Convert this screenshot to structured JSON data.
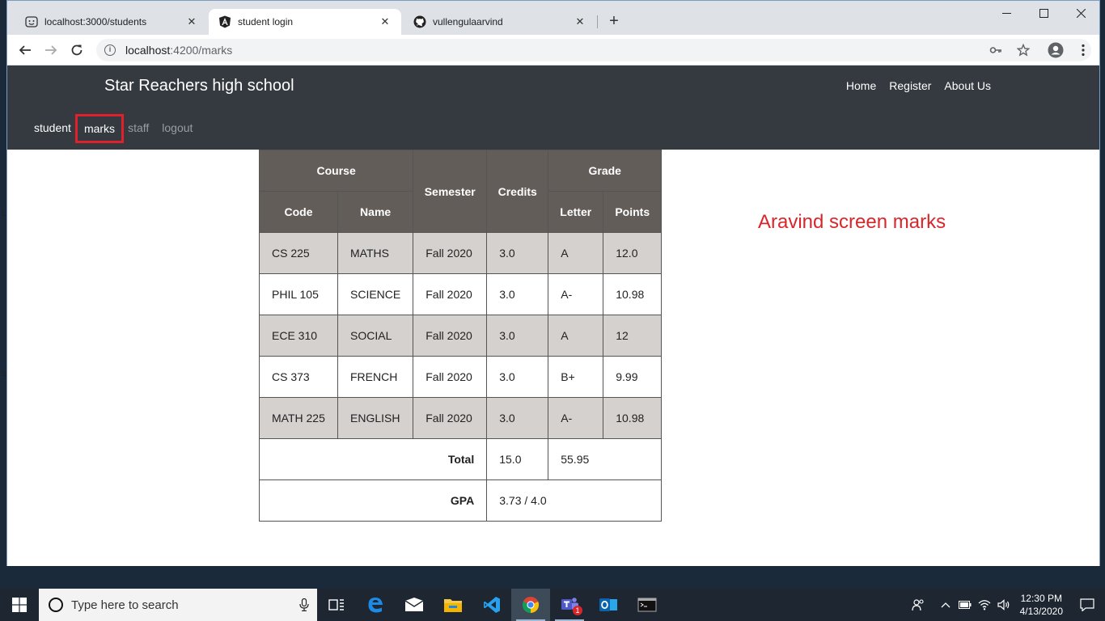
{
  "browser": {
    "tabs": [
      {
        "title": "localhost:3000/students",
        "icon": "smiley-favicon-icon"
      },
      {
        "title": "student login",
        "icon": "angular-icon"
      },
      {
        "title": "vullengulaarvind",
        "icon": "github-icon"
      }
    ],
    "url_host": "localhost",
    "url_rest": ":4200/marks"
  },
  "site": {
    "brand": "Star Reachers high school",
    "top_nav": [
      "Home",
      "Register",
      "About Us"
    ],
    "sub_nav": [
      "student",
      "marks",
      "staff",
      "logout"
    ]
  },
  "marks_table": {
    "headers": {
      "course": "Course",
      "code": "Code",
      "name": "Name",
      "semester": "Semester",
      "credits": "Credits",
      "grade": "Grade",
      "letter": "Letter",
      "points": "Points"
    },
    "rows": [
      {
        "code": "CS 225",
        "name": "MATHS",
        "semester": "Fall 2020",
        "credits": "3.0",
        "letter": "A",
        "points": "12.0"
      },
      {
        "code": "PHIL 105",
        "name": "SCIENCE",
        "semester": "Fall 2020",
        "credits": "3.0",
        "letter": "A-",
        "points": "10.98"
      },
      {
        "code": "ECE 310",
        "name": "SOCIAL",
        "semester": "Fall 2020",
        "credits": "3.0",
        "letter": "A",
        "points": "12"
      },
      {
        "code": "CS 373",
        "name": "FRENCH",
        "semester": "Fall 2020",
        "credits": "3.0",
        "letter": "B+",
        "points": "9.99"
      },
      {
        "code": "MATH 225",
        "name": "ENGLISH",
        "semester": "Fall 2020",
        "credits": "3.0",
        "letter": "A-",
        "points": "10.98"
      }
    ],
    "total_label": "Total",
    "total_credits": "15.0",
    "total_points": "55.95",
    "gpa_label": "GPA",
    "gpa_value": "3.73 / 4.0"
  },
  "annotation": "Aravind screen marks",
  "taskbar": {
    "search_placeholder": "Type here to search",
    "time": "12:30 PM",
    "date": "4/13/2020",
    "teams_badge": "1"
  },
  "colors": {
    "navbar": "#343a40",
    "table_header": "#635d5a",
    "table_stripe": "#d4d1cf",
    "annotation": "#d9262b",
    "highlight_box": "#e0202a"
  }
}
